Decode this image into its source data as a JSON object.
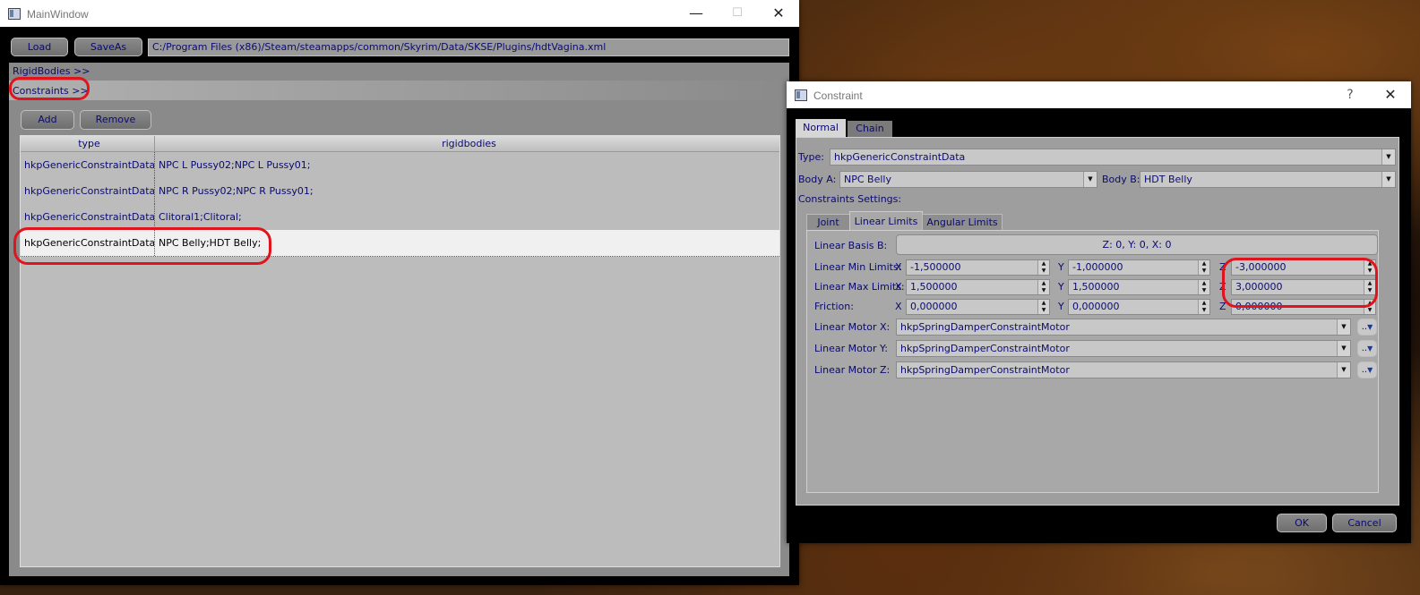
{
  "main_window": {
    "title": "MainWindow",
    "controls": {
      "minimize": "—",
      "maximize": "☐",
      "close": "✕"
    },
    "toolbar": {
      "load_label": "Load",
      "saveas_label": "SaveAs",
      "path": "C:/Program Files (x86)/Steam/steamapps/common/Skyrim/Data/SKSE/Plugins/hdtVagina.xml"
    },
    "sections": {
      "rigidbodies": "RigidBodies >>",
      "constraints": "Constraints >>"
    },
    "buttons": {
      "add": "Add",
      "remove": "Remove"
    },
    "table": {
      "headers": [
        "type",
        "rigidbodies"
      ],
      "rows": [
        [
          "hkpGenericConstraintData",
          "NPC L Pussy02;NPC L Pussy01;"
        ],
        [
          "hkpGenericConstraintData",
          "NPC R Pussy02;NPC R Pussy01;"
        ],
        [
          "hkpGenericConstraintData",
          "Clitoral1;Clitoral;"
        ],
        [
          "hkpGenericConstraintData",
          "NPC Belly;HDT Belly;"
        ]
      ]
    }
  },
  "constraint_dialog": {
    "title": "Constraint",
    "controls": {
      "help": "?",
      "close": "✕"
    },
    "tabs": [
      "Normal",
      "Chain"
    ],
    "type_label": "Type:",
    "type_value": "hkpGenericConstraintData",
    "body_a_label": "Body A:",
    "body_a_value": "NPC Belly",
    "body_b_label": "Body B:",
    "body_b_value": "HDT Belly",
    "settings_label": "Constraints Settings:",
    "inner_tabs": [
      "Joint",
      "Linear Limits",
      "Angular Limits"
    ],
    "basis_label": "Linear Basis B:",
    "basis_value": "Z: 0, Y: 0, X: 0",
    "axis_labels": {
      "x": "X",
      "y": "Y",
      "z": "Z"
    },
    "min_label": "Linear Min Limits:",
    "min_values": [
      "-1,500000",
      "-1,000000",
      "-3,000000"
    ],
    "max_label": "Linear Max Limits:",
    "max_values": [
      "1,500000",
      "1,500000",
      "3,000000"
    ],
    "friction_label": "Friction:",
    "friction_values": [
      "0,000000",
      "0,000000",
      "0,000000"
    ],
    "motor_x_label": "Linear Motor X:",
    "motor_y_label": "Linear Motor Y:",
    "motor_z_label": "Linear Motor Z:",
    "motor_value": "hkpSpringDamperConstraintMotor",
    "motor_edit_label": "..",
    "ok_label": "OK",
    "cancel_label": "Cancel"
  },
  "colors": {
    "annotation": "#e0141c",
    "text": "#0a0a6e"
  }
}
